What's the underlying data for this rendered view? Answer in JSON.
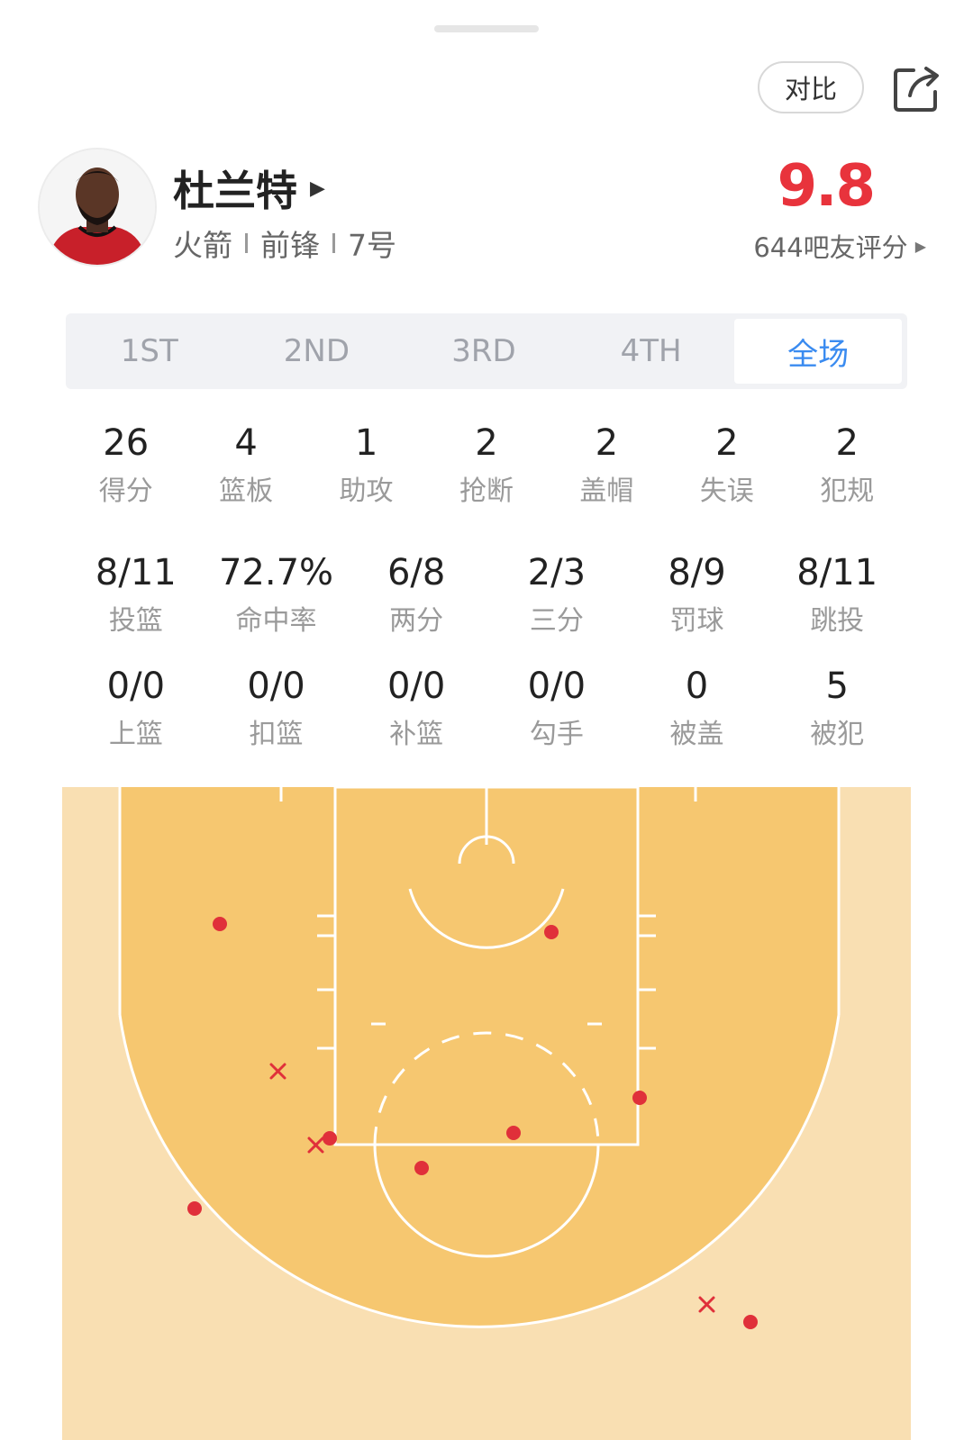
{
  "header": {
    "compare_label": "对比",
    "share_icon": "share-icon"
  },
  "player": {
    "name": "杜兰特",
    "team": "火箭",
    "position": "前锋",
    "number": "7号",
    "rating": "9.8",
    "rating_count": "644吧友评分"
  },
  "tabs": [
    {
      "label": "1ST",
      "active": false
    },
    {
      "label": "2ND",
      "active": false
    },
    {
      "label": "3RD",
      "active": false
    },
    {
      "label": "4TH",
      "active": false
    },
    {
      "label": "全场",
      "active": true
    }
  ],
  "stats_row1": [
    {
      "value": "26",
      "label": "得分"
    },
    {
      "value": "4",
      "label": "篮板"
    },
    {
      "value": "1",
      "label": "助攻"
    },
    {
      "value": "2",
      "label": "抢断"
    },
    {
      "value": "2",
      "label": "盖帽"
    },
    {
      "value": "2",
      "label": "失误"
    },
    {
      "value": "2",
      "label": "犯规"
    }
  ],
  "stats_row2": [
    {
      "value": "8/11",
      "label": "投篮"
    },
    {
      "value": "72.7%",
      "label": "命中率"
    },
    {
      "value": "6/8",
      "label": "两分"
    },
    {
      "value": "2/3",
      "label": "三分"
    },
    {
      "value": "8/9",
      "label": "罚球"
    },
    {
      "value": "8/11",
      "label": "跳投"
    }
  ],
  "stats_row3": [
    {
      "value": "0/0",
      "label": "上篮"
    },
    {
      "value": "0/0",
      "label": "扣篮"
    },
    {
      "value": "0/0",
      "label": "补篮"
    },
    {
      "value": "0/0",
      "label": "勾手"
    },
    {
      "value": "0",
      "label": "被盖"
    },
    {
      "value": "5",
      "label": "被犯"
    }
  ],
  "shot_chart": {
    "made_color": "#e0303a",
    "missed_color": "#e0303a",
    "court_color": "#f6c770",
    "outside_color": "#f9dfb2",
    "made_count": 8,
    "missed_count": 3
  }
}
